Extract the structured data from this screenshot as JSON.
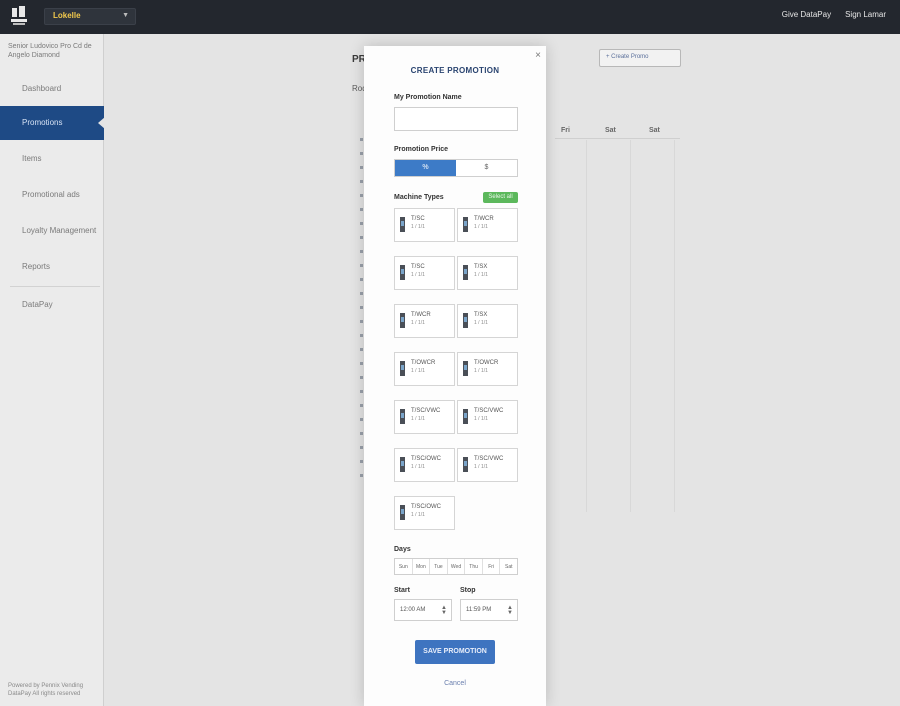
{
  "topbar": {
    "org_value": "Lokelle",
    "links": [
      "Give DataPay",
      "Sign Lamar"
    ]
  },
  "sidebar": {
    "header": "Senior Ludovico Pro Cd de Angelo Diamond",
    "items": [
      "Dashboard",
      "Promotions",
      "Items",
      "Promotional ads",
      "Loyalty Management",
      "Reports",
      "DataPay"
    ],
    "footer": "Powered by Pennix Vending DataPay All rights reserved"
  },
  "main": {
    "title": "PR",
    "subtitle": "Rod",
    "button_label": "+ Create Promo",
    "column_heads": [
      "Fri",
      "Sat",
      "Sat"
    ]
  },
  "modal": {
    "title": "CREATE PROMOTION",
    "close_glyph": "×",
    "name_label": "My Promotion Name",
    "name_value": "",
    "pct_label": "Promotion Price",
    "pct_options": [
      "%",
      "$"
    ],
    "types_label": "Machine Types",
    "select_all": "Select all",
    "machines": [
      {
        "name": "T/SC",
        "detail": "1 / 1/1"
      },
      {
        "name": "T/WCR",
        "detail": "1 / 1/1"
      },
      {
        "name": "T/SC",
        "detail": "1 / 1/1"
      },
      {
        "name": "T/SX",
        "detail": "1 / 1/1"
      },
      {
        "name": "T/WCR",
        "detail": "1 / 1/1"
      },
      {
        "name": "T/SX",
        "detail": "1 / 1/1"
      },
      {
        "name": "T/OWCR",
        "detail": "1 / 1/1"
      },
      {
        "name": "T/OWCR",
        "detail": "1 / 1/1"
      },
      {
        "name": "T/SC/VWC",
        "detail": "1 / 1/1"
      },
      {
        "name": "T/SC/VWC",
        "detail": "1 / 1/1"
      },
      {
        "name": "T/SC/OWC",
        "detail": "1 / 1/1"
      },
      {
        "name": "T/SC/VWC",
        "detail": "1 / 1/1"
      },
      {
        "name": "T/SC/OWC",
        "detail": "1 / 1/1"
      }
    ],
    "days_label": "Days",
    "days": [
      "Sun",
      "Mon",
      "Tue",
      "Wed",
      "Thu",
      "Fri",
      "Sat"
    ],
    "start_label": "Start",
    "start_value": "12:00 AM",
    "end_label": "Stop",
    "end_value": "11:59 PM",
    "save_label": "SAVE PROMOTION",
    "cancel_label": "Cancel"
  }
}
